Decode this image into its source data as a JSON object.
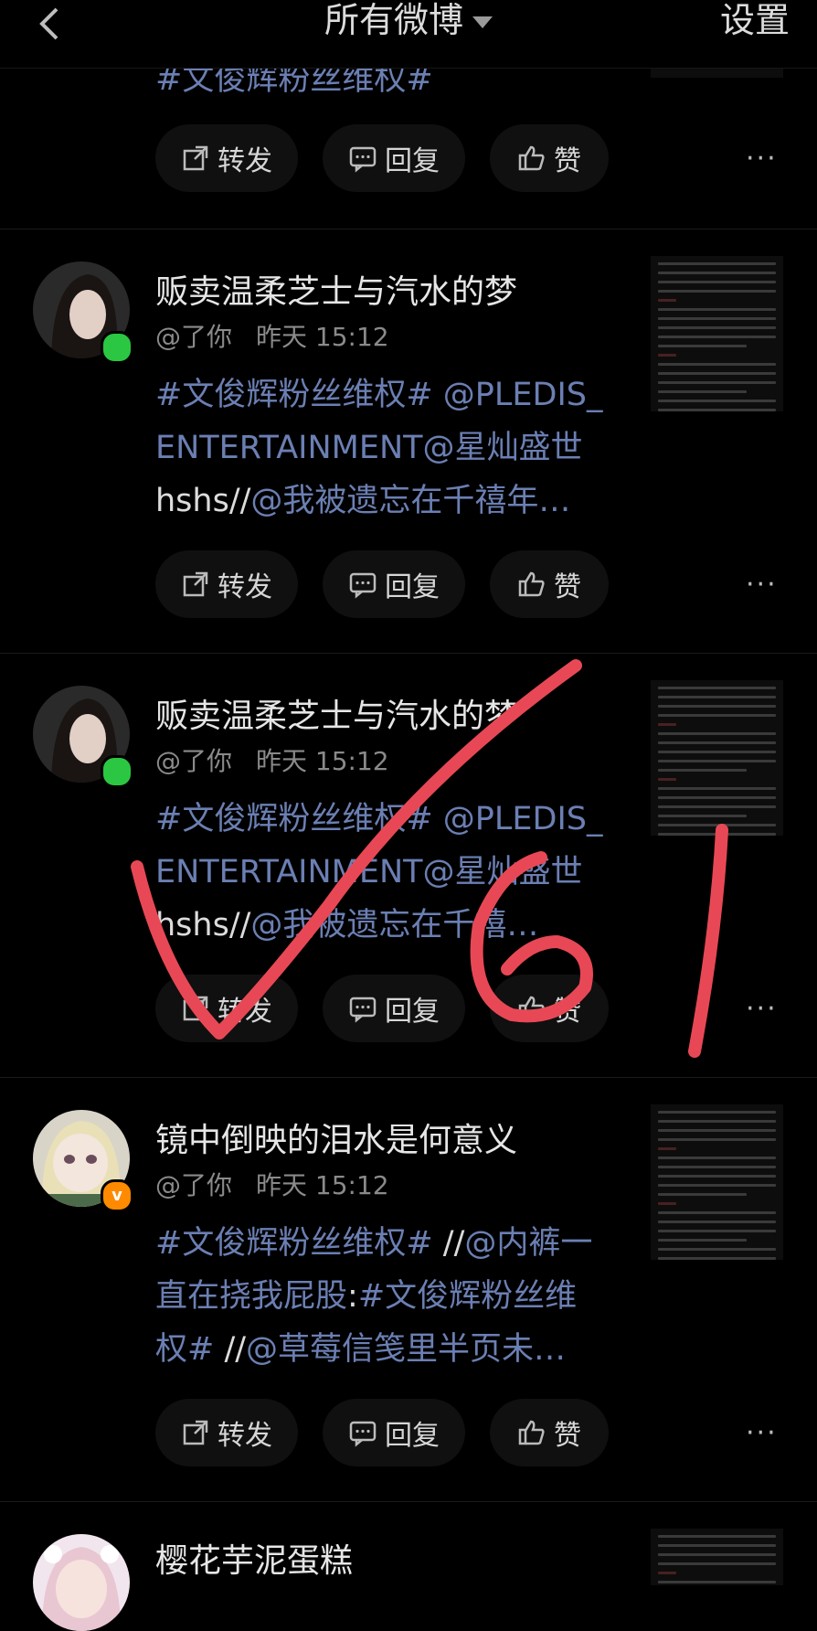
{
  "header": {
    "title": "所有微博",
    "settings": "设置"
  },
  "actions": {
    "repost": "转发",
    "reply": "回复",
    "like": "赞",
    "more": "···"
  },
  "top_partial": {
    "text": "#文俊辉粉丝维权#"
  },
  "posts": [
    {
      "name": "贩卖温柔芝士与汽水的梦",
      "user": "@了你",
      "time": "昨天 15:12",
      "lines": [
        [
          {
            "t": "#文俊辉粉丝维权# @PLEDIS_",
            "c": "blue"
          }
        ],
        [
          {
            "t": "ENTERTAINMENT@星灿盛世",
            "c": "blue"
          }
        ],
        [
          {
            "t": "hshs//",
            "c": "white"
          },
          {
            "t": "@我被遗忘在千禧年…",
            "c": "blue"
          }
        ]
      ]
    },
    {
      "name": "贩卖温柔芝士与汽水的梦",
      "user": "@了你",
      "time": "昨天 15:12",
      "lines": [
        [
          {
            "t": "#文俊辉粉丝维权# @PLEDIS_",
            "c": "blue"
          }
        ],
        [
          {
            "t": "ENTERTAINMENT@星灿盛世",
            "c": "blue"
          }
        ],
        [
          {
            "t": "hshs//",
            "c": "white"
          },
          {
            "t": "@我被遗忘在千禧…",
            "c": "blue"
          }
        ]
      ]
    },
    {
      "name": "镜中倒映的泪水是何意义",
      "user": "@了你",
      "time": "昨天 15:12",
      "lines": [
        [
          {
            "t": "#文俊辉粉丝维权# ",
            "c": "blue"
          },
          {
            "t": "//",
            "c": "white"
          },
          {
            "t": "@内裤一",
            "c": "blue"
          }
        ],
        [
          {
            "t": "直在挠我屁股",
            "c": "blue"
          },
          {
            "t": ":",
            "c": "white"
          },
          {
            "t": "#文俊辉粉丝维",
            "c": "blue"
          }
        ],
        [
          {
            "t": "权# ",
            "c": "blue"
          },
          {
            "t": "//",
            "c": "white"
          },
          {
            "t": "@草莓信笺里半页未…",
            "c": "blue"
          }
        ]
      ]
    },
    {
      "name": "樱花芋泥蛋糕",
      "user": "",
      "time": "",
      "lines": []
    }
  ],
  "colors": {
    "link": "#6b7fb3",
    "background": "#000000",
    "online": "#2bc742",
    "verified": "#ff8a00",
    "annotation": "#e84855"
  }
}
